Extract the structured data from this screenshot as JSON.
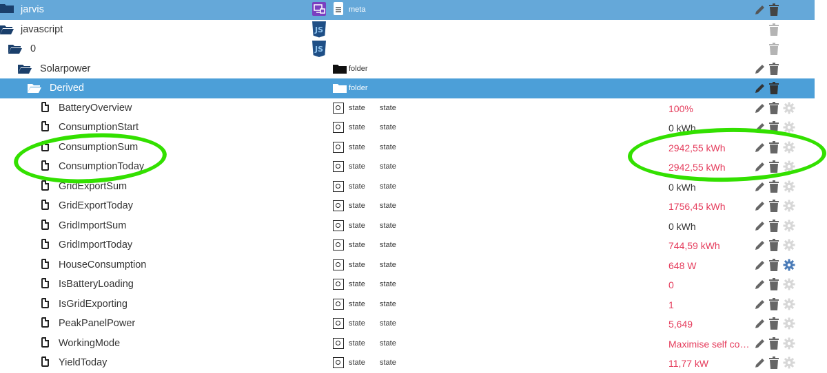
{
  "colors": {
    "selected_row": "#4c9fd8",
    "value_red": "#e53c5c",
    "highlight": "#33e000",
    "gear_active": "#4a7bb7"
  },
  "tree": {
    "jarvis": {
      "label": "jarvis",
      "type": "meta"
    },
    "javascript": {
      "label": "javascript"
    },
    "zero": {
      "label": "0"
    },
    "solarpower": {
      "label": "Solarpower",
      "type": "folder"
    },
    "derived": {
      "label": "Derived",
      "type": "folder"
    }
  },
  "states": [
    {
      "name": "BatteryOverview",
      "type": "state",
      "role": "state",
      "value": "100%"
    },
    {
      "name": "ConsumptionStart",
      "type": "state",
      "role": "state",
      "value": "0 kWh"
    },
    {
      "name": "ConsumptionSum",
      "type": "state",
      "role": "state",
      "value": "2942,55 kWh"
    },
    {
      "name": "ConsumptionToday",
      "type": "state",
      "role": "state",
      "value": "2942,55 kWh"
    },
    {
      "name": "GridExportSum",
      "type": "state",
      "role": "state",
      "value": "0 kWh"
    },
    {
      "name": "GridExportToday",
      "type": "state",
      "role": "state",
      "value": "1756,45 kWh"
    },
    {
      "name": "GridImportSum",
      "type": "state",
      "role": "state",
      "value": "0 kWh"
    },
    {
      "name": "GridImportToday",
      "type": "state",
      "role": "state",
      "value": "744,59 kWh"
    },
    {
      "name": "HouseConsumption",
      "type": "state",
      "role": "state",
      "value": "648 W"
    },
    {
      "name": "IsBatteryLoading",
      "type": "state",
      "role": "state",
      "value": "0"
    },
    {
      "name": "IsGridExporting",
      "type": "state",
      "role": "state",
      "value": "1"
    },
    {
      "name": "PeakPanelPower",
      "type": "state",
      "role": "state",
      "value": "5,649"
    },
    {
      "name": "WorkingMode",
      "type": "state",
      "role": "state",
      "value": "Maximise self consumption"
    },
    {
      "name": "YieldToday",
      "type": "state",
      "role": "state",
      "value": "11,77 kW"
    }
  ]
}
